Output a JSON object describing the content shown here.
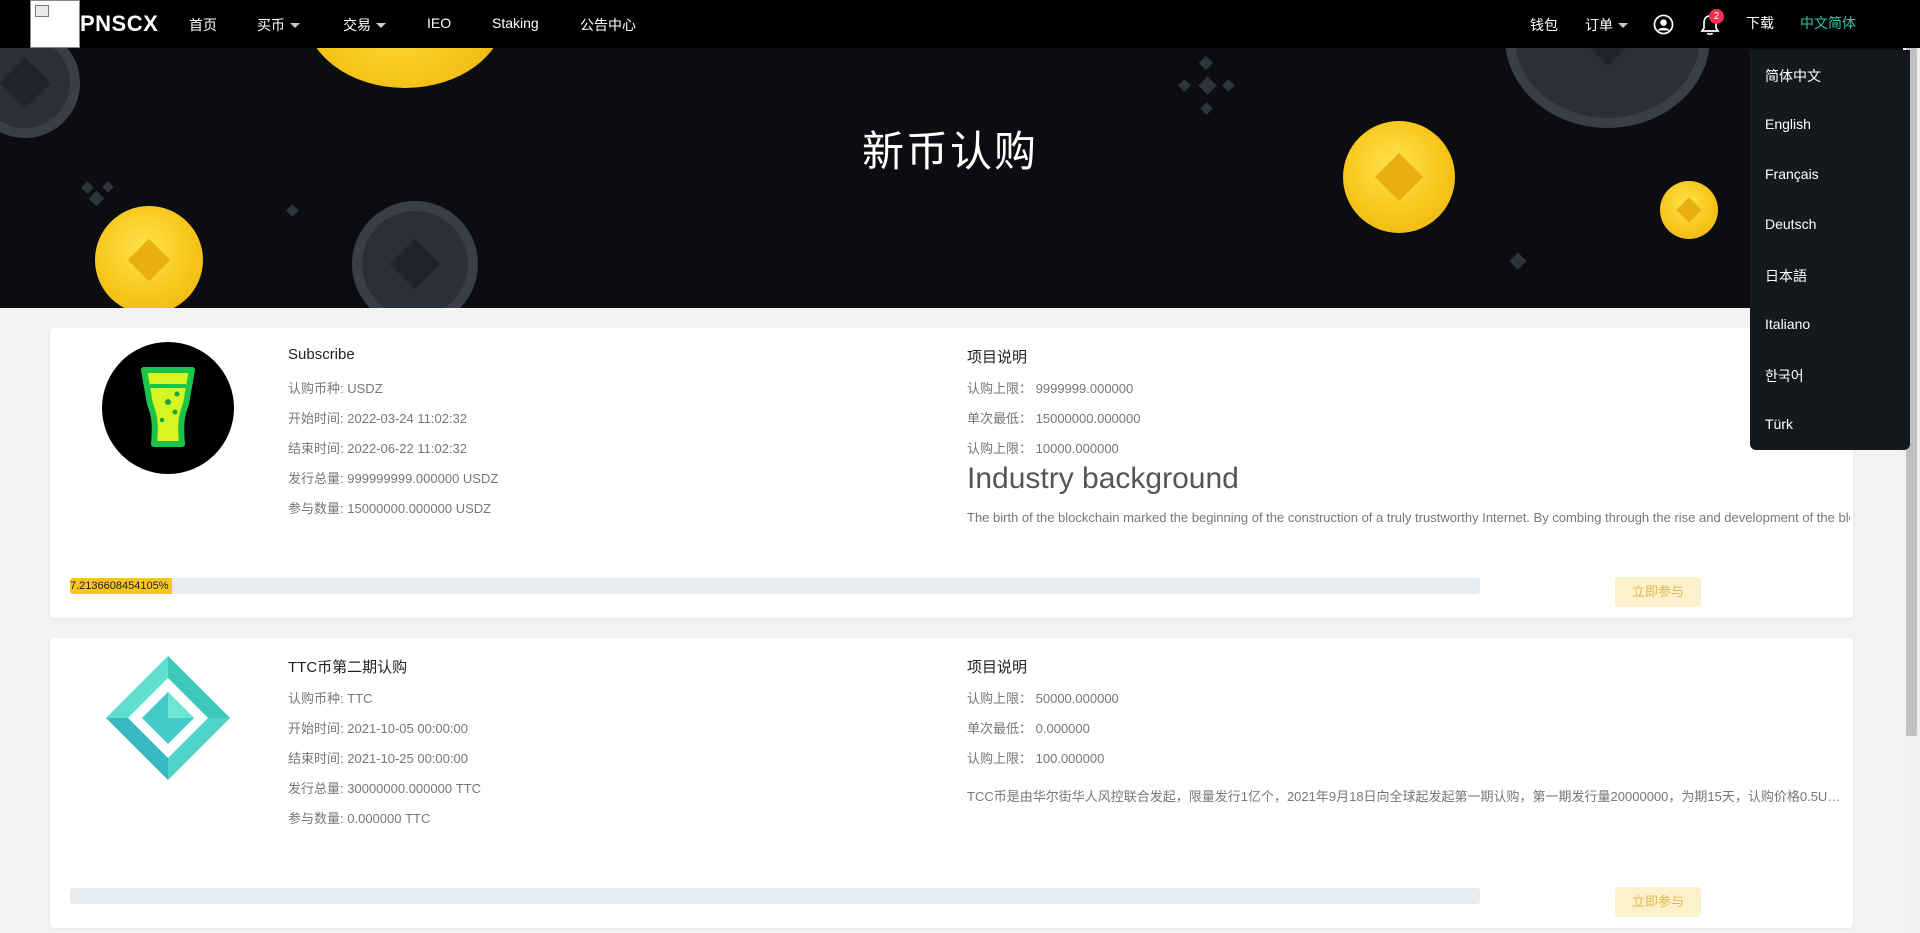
{
  "nav": {
    "brand": "PNSCX",
    "items": [
      "首页",
      "买币",
      "交易",
      "IEO",
      "Staking",
      "公告中心"
    ],
    "wallet": "钱包",
    "orders": "订单",
    "notification_count": "2",
    "download": "下载",
    "language": "中文简体"
  },
  "hero": {
    "title": "新币认购"
  },
  "language_menu": [
    "简体中文",
    "English",
    "Français",
    "Deutsch",
    "日本語",
    "Italiano",
    "한국어",
    "Türk"
  ],
  "projects": [
    {
      "title": "Subscribe",
      "coin_label": "认购币种:",
      "coin": "USDZ",
      "start_label": "开始时间:",
      "start": "2022-03-24 11:02:32",
      "end_label": "结束时间:",
      "end": "2022-06-22 11:02:32",
      "total_label": "发行总量:",
      "total": "999999999.000000 USDZ",
      "joined_label": "参与数量:",
      "joined": "15000000.000000 USDZ",
      "desc_title": "项目说明",
      "max_label": "认购上限：",
      "max": "9999999.000000",
      "min_label": "单次最低：",
      "min": "15000000.000000",
      "max2_label": "认购上限：",
      "max2": "10000.000000",
      "bg_heading": "Industry background",
      "bg_text": "The birth of the blockchain marked the beginning of the construction of a truly trustworthy Internet. By combing through the rise and development of the blockchain industry, we found",
      "progress_text": "7.2136608454105%",
      "progress": 0.0721,
      "button": "立即参与"
    },
    {
      "title": "TTC币第二期认购",
      "coin_label": "认购币种:",
      "coin": "TTC",
      "start_label": "开始时间:",
      "start": "2021-10-05 00:00:00",
      "end_label": "结束时间:",
      "end": "2021-10-25 00:00:00",
      "total_label": "发行总量:",
      "total": "30000000.000000 TTC",
      "joined_label": "参与数量:",
      "joined": "0.000000 TTC",
      "desc_title": "项目说明",
      "max_label": "认购上限：",
      "max": "50000.000000",
      "min_label": "单次最低：",
      "min": "0.000000",
      "max2_label": "认购上限：",
      "max2": "100.000000",
      "desc_long": "TCC币是由华尔街华人风控联合发起，限量发行1亿个，2021年9月18日向全球起发起第一期认购，第一期发行量20000000，为期15天，认购价格0.5USDT，第二期认购价格",
      "progress": 0,
      "button": "立即参与"
    }
  ]
}
